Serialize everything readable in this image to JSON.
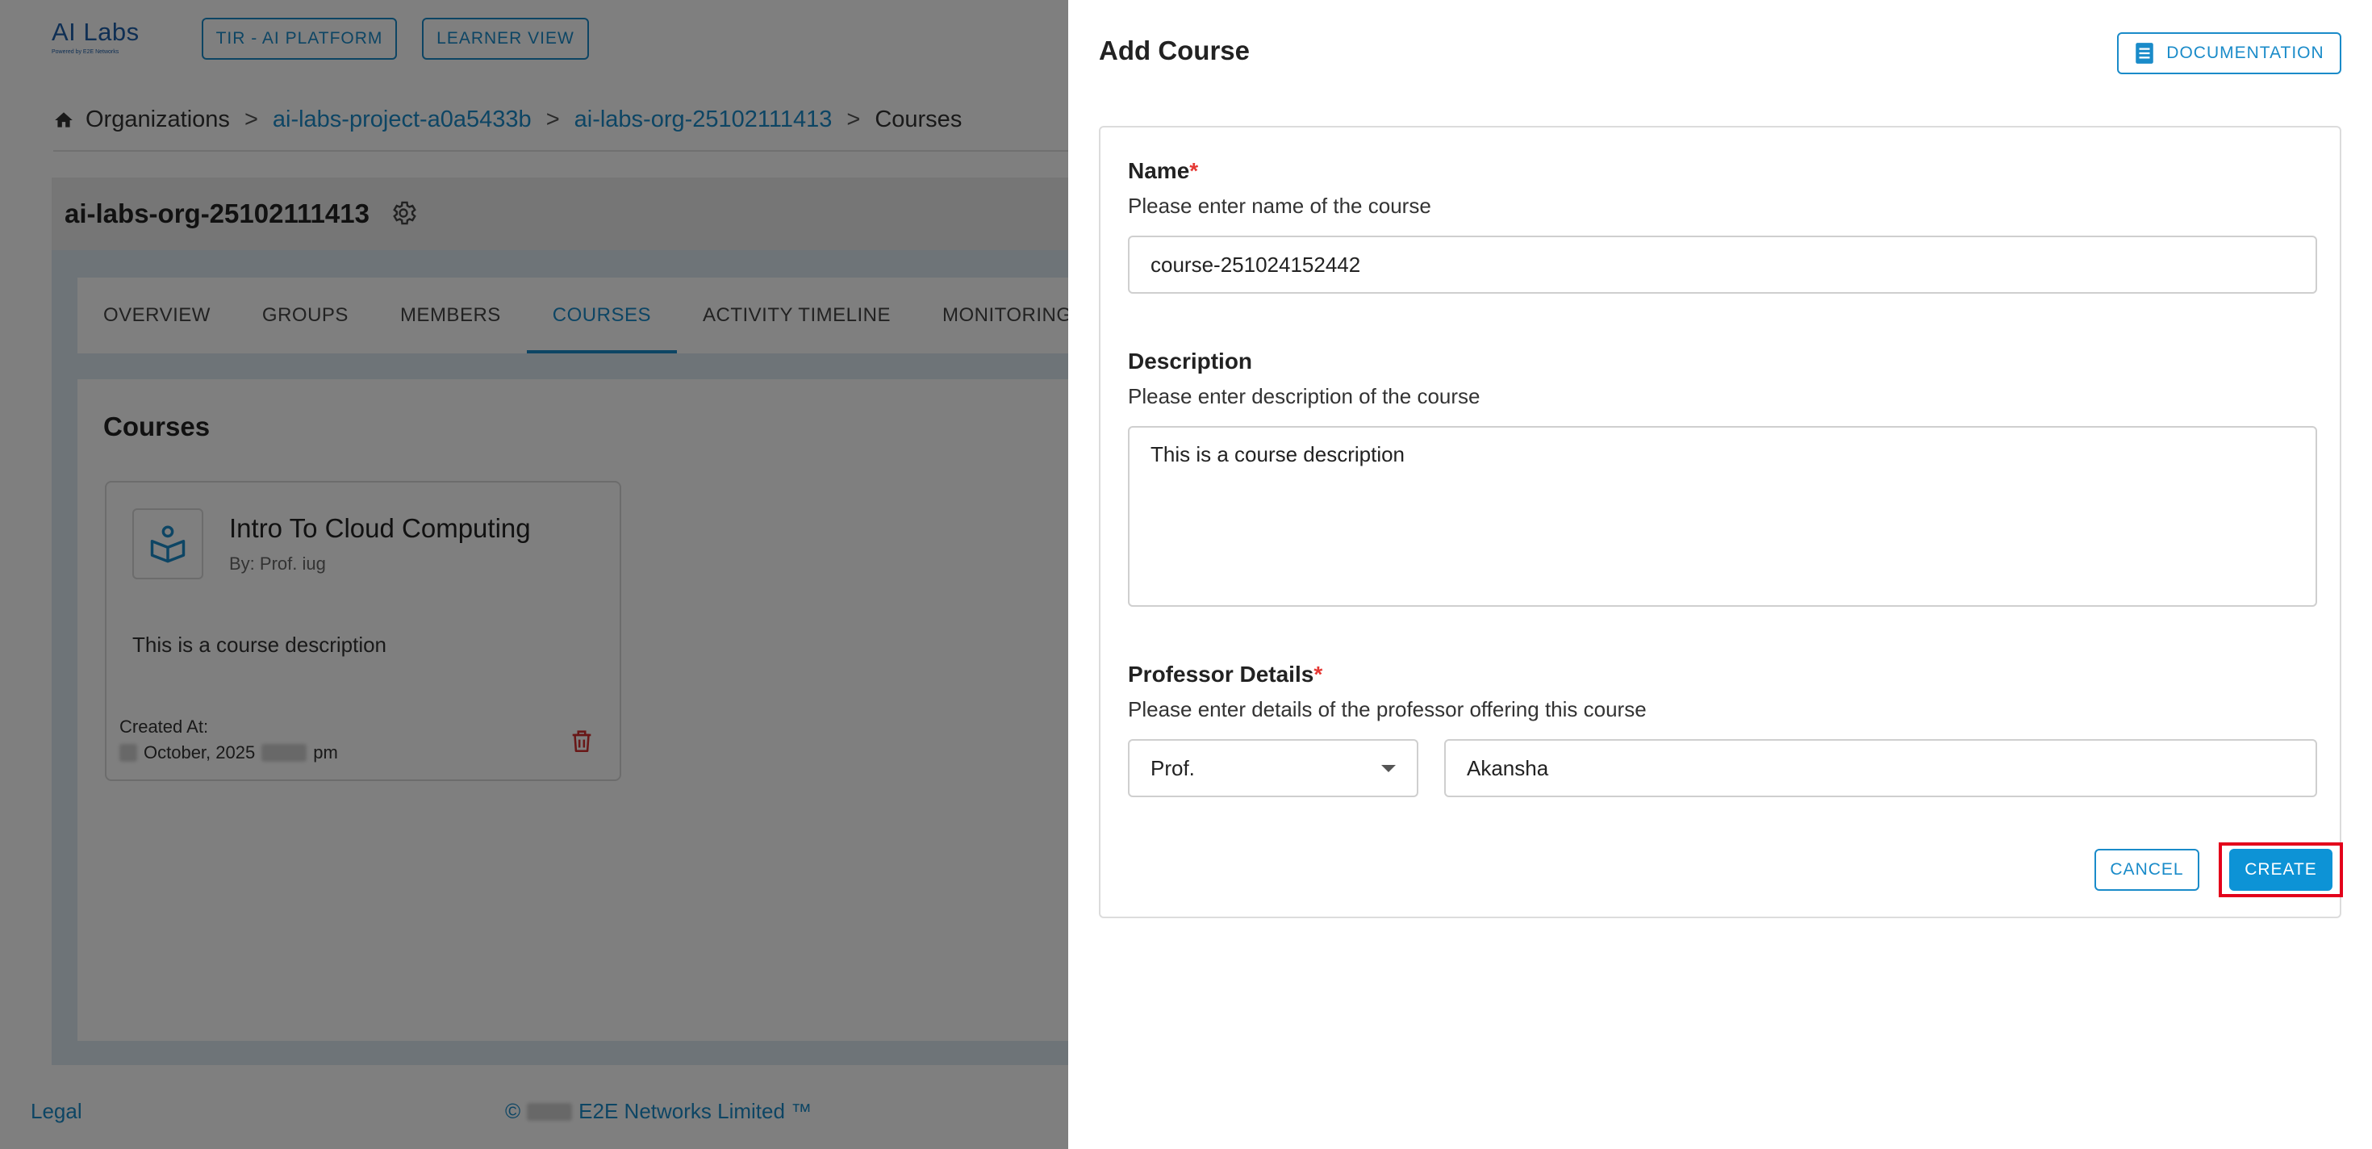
{
  "app": {
    "logo_text": "AI Labs",
    "logo_subtext": "Powered by E2E Networks",
    "top_buttons": [
      "TIR - AI PLATFORM",
      "LEARNER VIEW"
    ]
  },
  "breadcrumb": {
    "items": [
      "Organizations",
      "ai-labs-project-a0a5433b",
      "ai-labs-org-25102111413",
      "Courses"
    ],
    "separator": ">"
  },
  "org": {
    "title": "ai-labs-org-25102111413"
  },
  "tabs": [
    {
      "label": "OVERVIEW",
      "active": false
    },
    {
      "label": "GROUPS",
      "active": false
    },
    {
      "label": "MEMBERS",
      "active": false
    },
    {
      "label": "COURSES",
      "active": true
    },
    {
      "label": "ACTIVITY TIMELINE",
      "active": false
    },
    {
      "label": "MONITORING",
      "active": false
    }
  ],
  "courses": {
    "title": "Courses",
    "cards": [
      {
        "name": "Intro To Cloud Computing",
        "by": "By: Prof. iug",
        "description": "This is a course description",
        "created_label": "Created At:",
        "created_month": "October, 2025",
        "created_suffix": "pm"
      }
    ]
  },
  "footer": {
    "legal": "Legal",
    "copyright_symbol": "©",
    "company": "E2E Networks Limited ™"
  },
  "drawer": {
    "title": "Add Course",
    "documentation_label": "DOCUMENTATION",
    "name": {
      "label": "Name",
      "required": "*",
      "help": "Please enter name of the course",
      "value": "course-251024152442"
    },
    "description": {
      "label": "Description",
      "help": "Please enter description of the course",
      "value": "This is a course description"
    },
    "professor": {
      "label": "Professor Details",
      "required": "*",
      "help": "Please enter details of the professor offering this course",
      "title_value": "Prof.",
      "name_value": "Akansha"
    },
    "cancel_label": "CANCEL",
    "create_label": "CREATE"
  },
  "colors": {
    "accent": "#1a8bc9",
    "primary_button": "#0d93d6",
    "required": "#e53935",
    "highlight_box": "#e3001b",
    "delete": "#d32f2f"
  }
}
